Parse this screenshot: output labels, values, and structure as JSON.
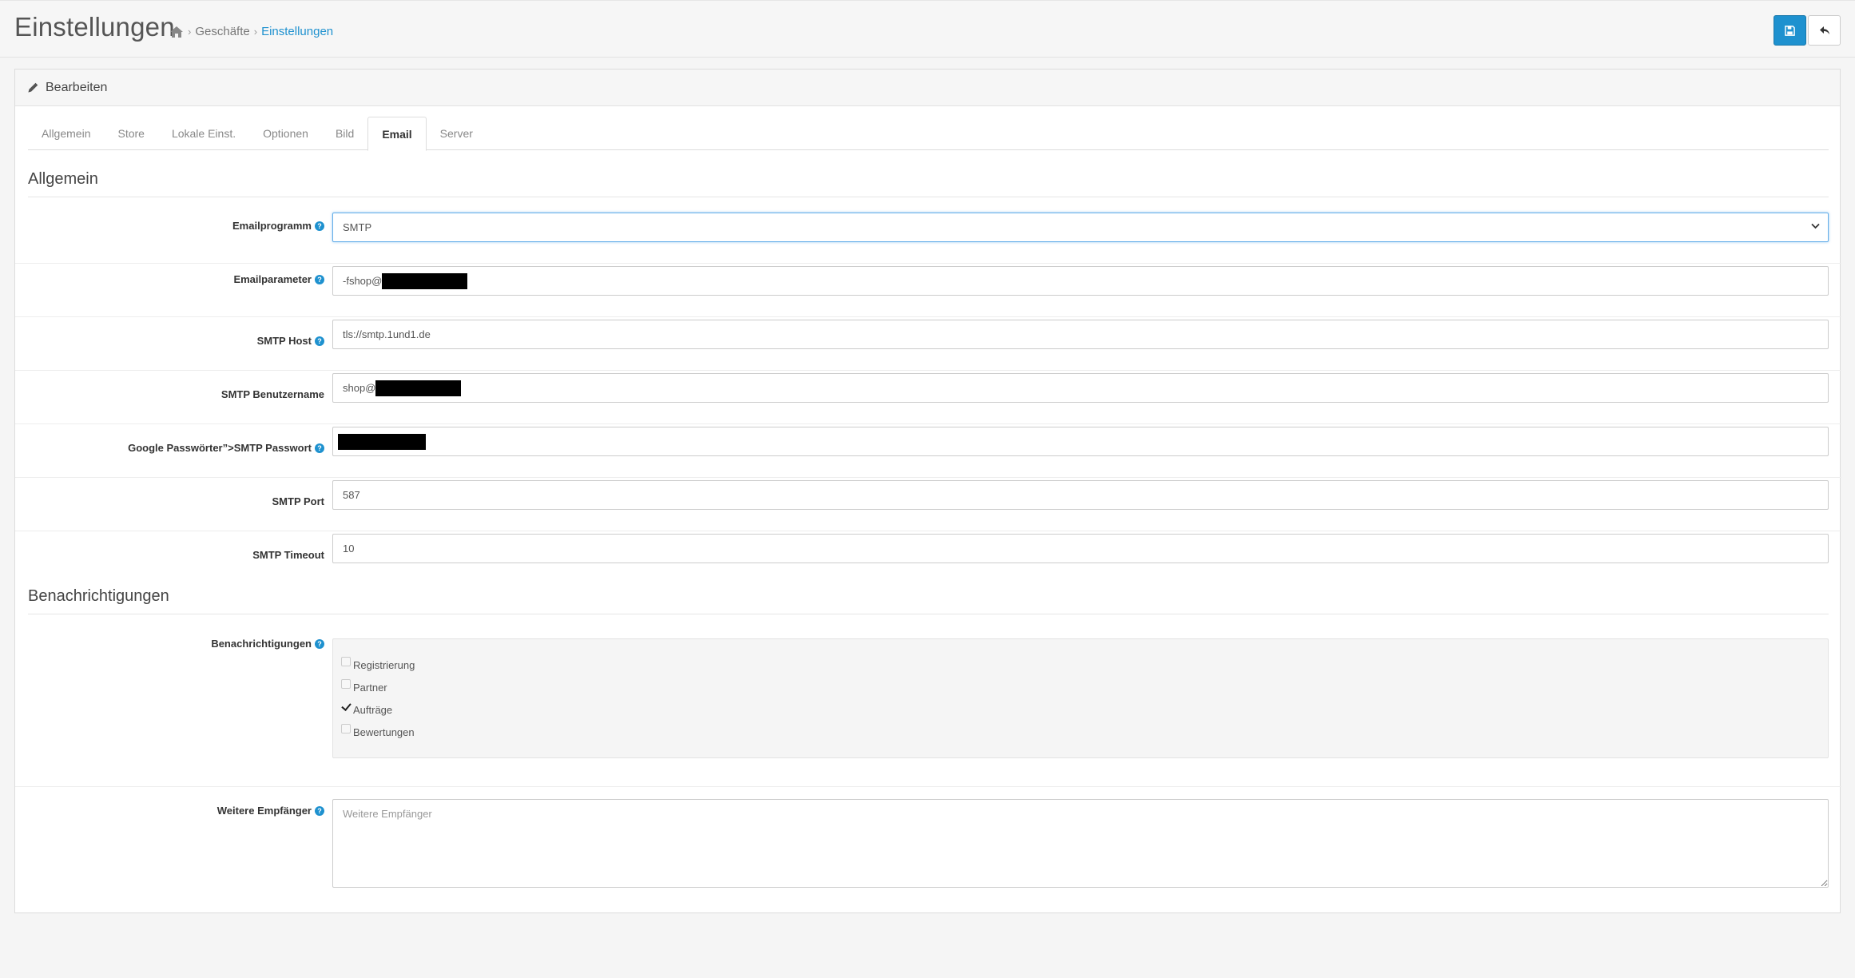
{
  "header": {
    "title": "Einstellungen",
    "breadcrumb": [
      "Geschäfte",
      "Einstellungen"
    ],
    "icons": {
      "home": "home-icon",
      "save": "save-icon",
      "back": "reply-icon"
    }
  },
  "panel": {
    "heading": "Bearbeiten",
    "heading_icon": "pencil-icon"
  },
  "tabs": [
    {
      "label": "Allgemein",
      "active": false
    },
    {
      "label": "Store",
      "active": false
    },
    {
      "label": "Lokale Einst.",
      "active": false
    },
    {
      "label": "Optionen",
      "active": false
    },
    {
      "label": "Bild",
      "active": false
    },
    {
      "label": "Email",
      "active": true
    },
    {
      "label": "Server",
      "active": false
    }
  ],
  "sections": {
    "general": "Allgemein",
    "notifications": "Benachrichtigungen"
  },
  "fields": {
    "mail_engine": {
      "label": "Emailprogramm",
      "value": "SMTP"
    },
    "mail_parameter": {
      "label": "Emailparameter",
      "value": "-fshop@"
    },
    "smtp_host": {
      "label": "SMTP Host",
      "value": "tls://smtp.1und1.de"
    },
    "smtp_username": {
      "label": "SMTP Benutzername",
      "value": "shop@"
    },
    "smtp_password": {
      "label": "Google Passwörter”>SMTP Passwort",
      "value": ""
    },
    "smtp_port": {
      "label": "SMTP Port",
      "value": "587"
    },
    "smtp_timeout": {
      "label": "SMTP Timeout",
      "value": "10"
    },
    "notifications": {
      "label": "Benachrichtigungen",
      "options": [
        {
          "label": "Registrierung",
          "checked": false
        },
        {
          "label": "Partner",
          "checked": false
        },
        {
          "label": "Aufträge",
          "checked": true
        },
        {
          "label": "Bewertungen",
          "checked": false
        }
      ]
    },
    "additional_recipients": {
      "label": "Weitere Empfänger",
      "placeholder": "Weitere Empfänger",
      "value": ""
    }
  },
  "colors": {
    "primary": "#1e91cf",
    "background": "#f5f5f5",
    "redaction": "#000000"
  }
}
